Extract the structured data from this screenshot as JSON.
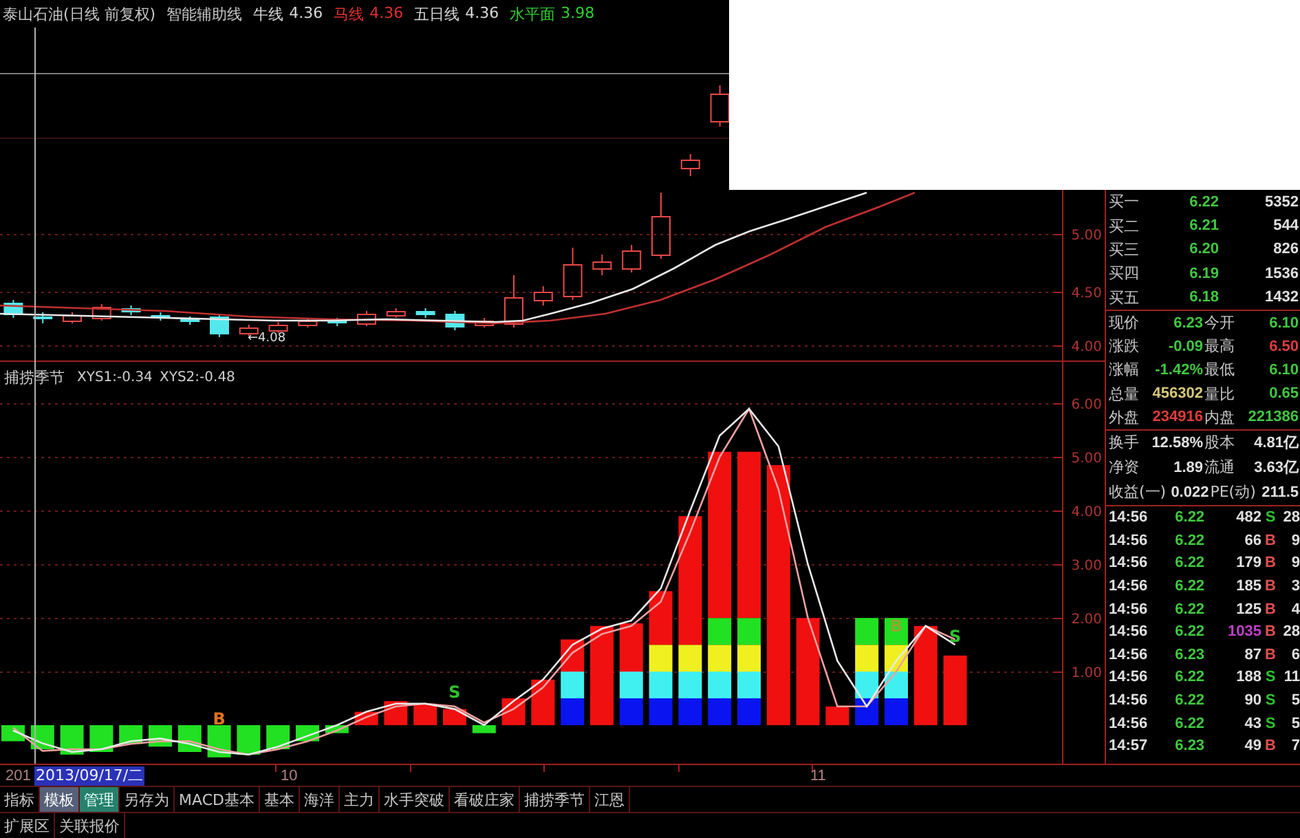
{
  "header": {
    "title": "泰山石油(日线 前复权)",
    "indicator": "智能辅助线",
    "lines": [
      {
        "name": "牛线",
        "value": "4.36",
        "color": "#d8d8d8"
      },
      {
        "name": "马线",
        "value": "4.36",
        "color": "#e03030"
      },
      {
        "name": "五日线",
        "value": "4.36",
        "color": "#d8d8d8"
      },
      {
        "name": "水平面",
        "value": "3.98",
        "color": "#30d030"
      }
    ]
  },
  "price_chart": {
    "axis_labels": [
      "5.00",
      "4.50",
      "4.00"
    ],
    "low_marker": "←4.08"
  },
  "indicator_panel": {
    "name": "捕捞季节",
    "readings": [
      "XYS1:-0.34",
      "XYS2:-0.48"
    ],
    "axis_labels": [
      "6.00",
      "5.00",
      "4.00",
      "3.00",
      "2.00",
      "1.00"
    ],
    "signals": [
      {
        "text": "B",
        "color": "#e07020"
      },
      {
        "text": "S",
        "color": "#30c030"
      },
      {
        "text": "B",
        "color": "#90a830"
      },
      {
        "text": "S",
        "color": "#30c030"
      }
    ]
  },
  "order_book": [
    {
      "label": "买一",
      "price": "6.22",
      "volume": "5352"
    },
    {
      "label": "买二",
      "price": "6.21",
      "volume": "544"
    },
    {
      "label": "买三",
      "price": "6.20",
      "volume": "826"
    },
    {
      "label": "买四",
      "price": "6.19",
      "volume": "1536"
    },
    {
      "label": "买五",
      "price": "6.18",
      "volume": "1432"
    }
  ],
  "quote": [
    {
      "cells": [
        {
          "label": "现价",
          "value": "6.23",
          "color": "#40c840"
        },
        {
          "label": "今开",
          "value": "6.10",
          "color": "#40c840"
        }
      ]
    },
    {
      "cells": [
        {
          "label": "涨跌",
          "value": "-0.09",
          "color": "#40c840"
        },
        {
          "label": "最高",
          "value": "6.50",
          "color": "#e03c3c"
        }
      ]
    },
    {
      "cells": [
        {
          "label": "涨幅",
          "value": "-1.42%",
          "color": "#40c840"
        },
        {
          "label": "最低",
          "value": "6.10",
          "color": "#40c840"
        }
      ]
    },
    {
      "cells": [
        {
          "label": "总量",
          "value": "456302",
          "color": "#d8c878"
        },
        {
          "label": "量比",
          "value": "0.65",
          "color": "#40c840"
        }
      ]
    },
    {
      "cells": [
        {
          "label": "外盘",
          "value": "234916",
          "color": "#e03c3c"
        },
        {
          "label": "内盘",
          "value": "221386",
          "color": "#40c840"
        }
      ]
    }
  ],
  "fundamentals": [
    {
      "cells": [
        {
          "label": "换手",
          "value": "12.58%"
        },
        {
          "label": "股本",
          "value": "4.81亿"
        }
      ]
    },
    {
      "cells": [
        {
          "label": "净资",
          "value": "1.89"
        },
        {
          "label": "流通",
          "value": "3.63亿"
        }
      ]
    },
    {
      "cells": [
        {
          "label": "收益(一)",
          "value": "0.022"
        },
        {
          "label": "PE(动)",
          "value": "211.5"
        }
      ]
    }
  ],
  "ticks": [
    {
      "time": "14:56",
      "price": "6.22",
      "volume": "482",
      "large": false,
      "side": "S",
      "kind": "sell",
      "trades": "28"
    },
    {
      "time": "14:56",
      "price": "6.22",
      "volume": "66",
      "large": false,
      "side": "B",
      "kind": "buy",
      "trades": "9"
    },
    {
      "time": "14:56",
      "price": "6.22",
      "volume": "179",
      "large": false,
      "side": "B",
      "kind": "buy",
      "trades": "9"
    },
    {
      "time": "14:56",
      "price": "6.22",
      "volume": "185",
      "large": false,
      "side": "B",
      "kind": "buy",
      "trades": "3"
    },
    {
      "time": "14:56",
      "price": "6.22",
      "volume": "125",
      "large": false,
      "side": "B",
      "kind": "buy",
      "trades": "4"
    },
    {
      "time": "14:56",
      "price": "6.22",
      "volume": "1035",
      "large": true,
      "side": "B",
      "kind": "buy",
      "trades": "28"
    },
    {
      "time": "14:56",
      "price": "6.23",
      "volume": "87",
      "large": false,
      "side": "B",
      "kind": "buy",
      "trades": "6"
    },
    {
      "time": "14:56",
      "price": "6.22",
      "volume": "188",
      "large": false,
      "side": "S",
      "kind": "sell",
      "trades": "11"
    },
    {
      "time": "14:56",
      "price": "6.22",
      "volume": "90",
      "large": false,
      "side": "S",
      "kind": "sell",
      "trades": "5"
    },
    {
      "time": "14:56",
      "price": "6.22",
      "volume": "43",
      "large": false,
      "side": "S",
      "kind": "sell",
      "trades": "5"
    },
    {
      "time": "14:57",
      "price": "6.23",
      "volume": "49",
      "large": false,
      "side": "B",
      "kind": "buy",
      "trades": "7"
    }
  ],
  "date_axis": {
    "labels": [
      "201",
      "10",
      "11"
    ],
    "cursor_date": "2013/09/17/二"
  },
  "tabs": [
    {
      "label": "指标",
      "selected": false,
      "highlighted": false
    },
    {
      "label": "模板",
      "selected": true,
      "highlighted": false
    },
    {
      "label": "管理",
      "selected": false,
      "highlighted": true
    },
    {
      "label": "另存为",
      "selected": false,
      "highlighted": false
    },
    {
      "label": "MACD基本",
      "selected": false,
      "highlighted": false
    },
    {
      "label": "基本",
      "selected": false,
      "highlighted": false
    },
    {
      "label": "海洋",
      "selected": false,
      "highlighted": false
    },
    {
      "label": "主力",
      "selected": false,
      "highlighted": false
    },
    {
      "label": "水手突破",
      "selected": false,
      "highlighted": false
    },
    {
      "label": "看破庄家",
      "selected": false,
      "highlighted": false
    },
    {
      "label": "捕捞季节",
      "selected": false,
      "highlighted": false
    },
    {
      "label": "江恩",
      "selected": false,
      "highlighted": false
    }
  ],
  "bottom_bar": [
    {
      "label": "扩展区"
    },
    {
      "label": "关联报价"
    }
  ]
}
